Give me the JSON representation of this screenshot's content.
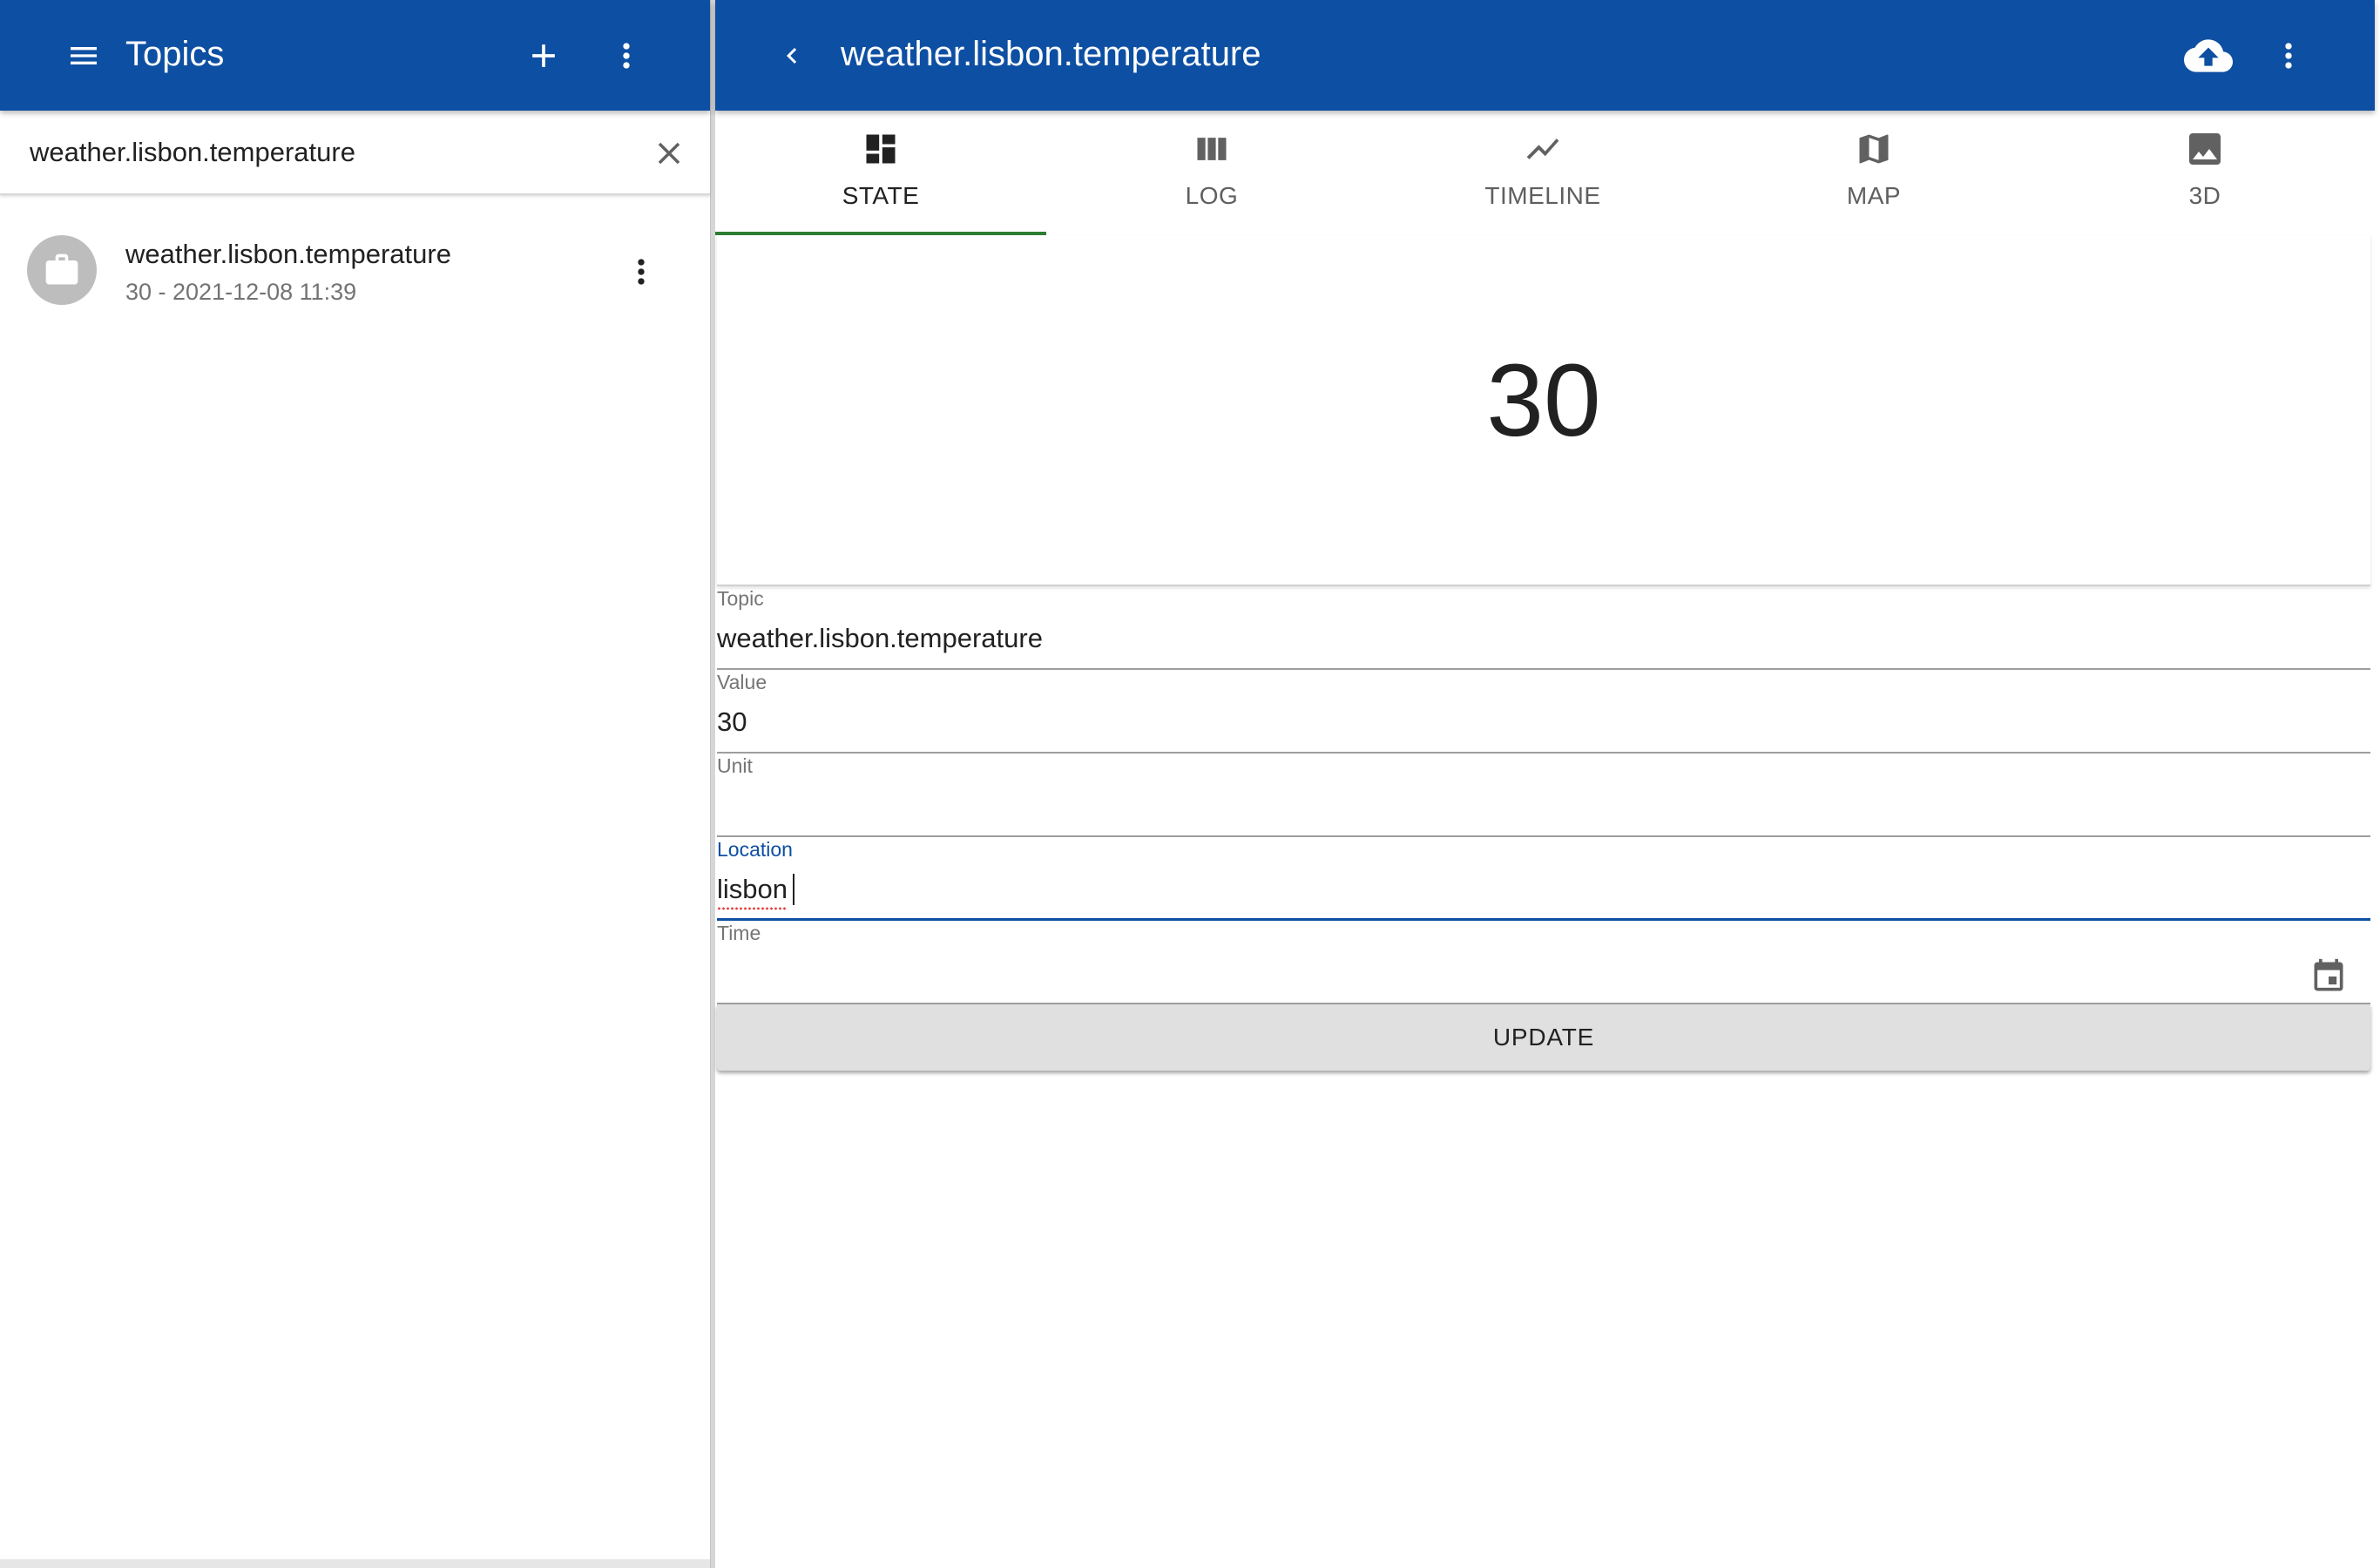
{
  "left": {
    "title": "Topics",
    "search": {
      "value": "weather.lisbon.temperature",
      "placeholder": ""
    },
    "items": [
      {
        "primary": "weather.lisbon.temperature",
        "secondary": "30 - 2021-12-08 11:39",
        "avatar_icon": "briefcase-icon"
      }
    ]
  },
  "right": {
    "title": "weather.lisbon.temperature",
    "tabs": [
      {
        "label": "STATE",
        "icon": "dashboard-icon",
        "active": true
      },
      {
        "label": "LOG",
        "icon": "view-column-icon",
        "active": false
      },
      {
        "label": "TIMELINE",
        "icon": "timeline-icon",
        "active": false
      },
      {
        "label": "MAP",
        "icon": "map-icon",
        "active": false
      },
      {
        "label": "3D",
        "icon": "image-icon",
        "active": false
      }
    ],
    "state_value": "30",
    "form": {
      "topic": {
        "label": "Topic",
        "value": "weather.lisbon.temperature"
      },
      "value": {
        "label": "Value",
        "value": "30"
      },
      "unit": {
        "label": "Unit",
        "value": ""
      },
      "location": {
        "label": "Location",
        "value": "lisbon"
      },
      "time": {
        "label": "Time",
        "value": ""
      }
    },
    "update_label": "UPDATE"
  },
  "colors": {
    "appbar": "#0d4fa2",
    "active_tab_indicator": "#2e7d32",
    "focused_field": "#0d4fa2",
    "button_bg": "#e0e0e0"
  }
}
